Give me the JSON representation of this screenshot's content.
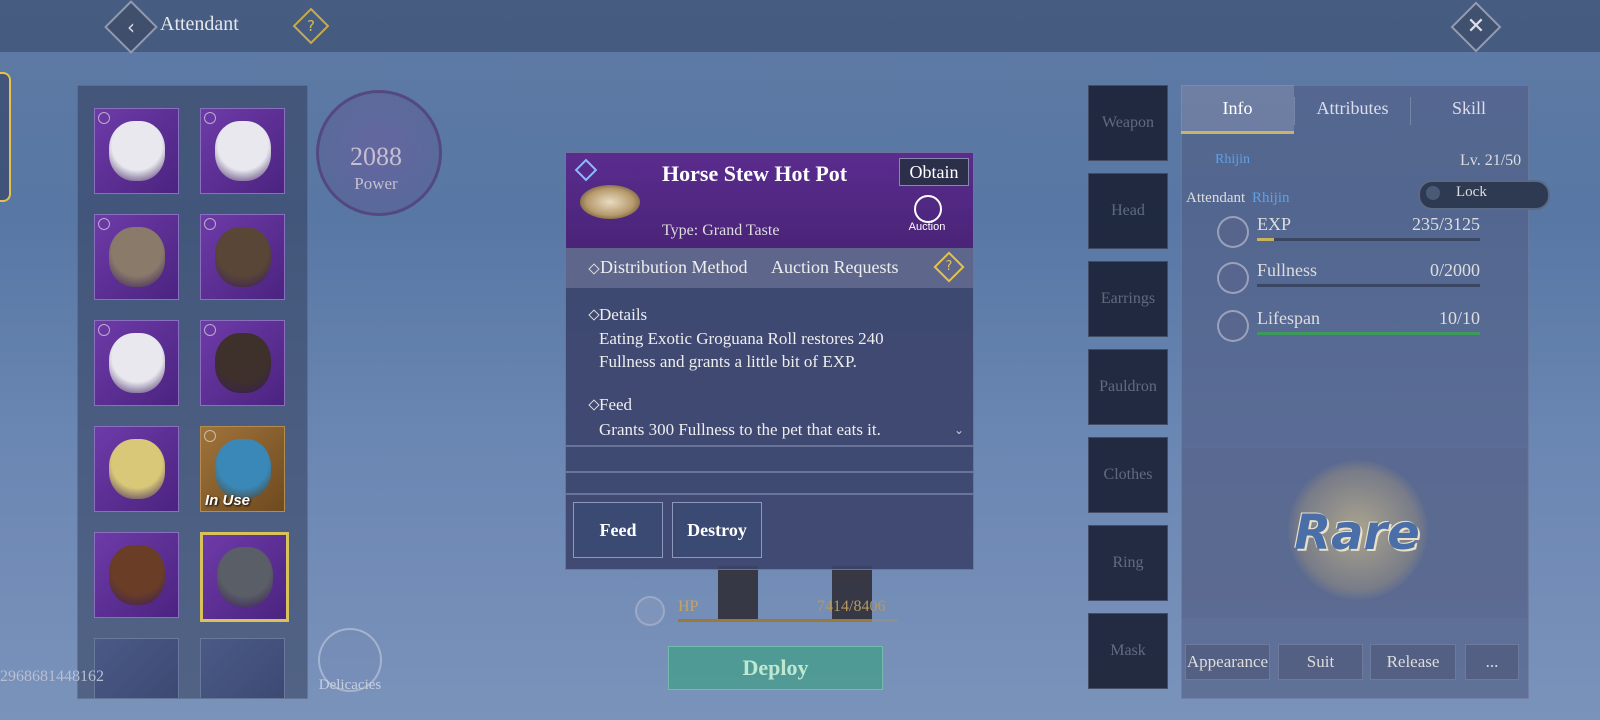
{
  "header": {
    "title": "Attendant",
    "help": "?",
    "back": "‹",
    "close": "✕"
  },
  "pets": [
    {
      "name": "white-fox",
      "color": "#e8e8ee",
      "in_use": false,
      "locked": true
    },
    {
      "name": "white-fox",
      "color": "#e8e8ee",
      "in_use": false,
      "locked": true
    },
    {
      "name": "tabby-cat",
      "color": "#8a7a6a",
      "in_use": false,
      "locked": true
    },
    {
      "name": "buffalo",
      "color": "#5a4636",
      "in_use": false,
      "locked": true
    },
    {
      "name": "white-fox",
      "color": "#e8e8ee",
      "in_use": false,
      "locked": true
    },
    {
      "name": "chimpanzee",
      "color": "#3e302a",
      "in_use": false,
      "locked": true
    },
    {
      "name": "blonde-girl",
      "color": "#d8c878",
      "in_use": false,
      "locked": false
    },
    {
      "name": "parrot",
      "color": "#3a88b8",
      "in_use": true,
      "locked": true
    },
    {
      "name": "bear",
      "color": "#6a3e26",
      "in_use": false,
      "locked": false
    },
    {
      "name": "rhino",
      "color": "#5a5e66",
      "in_use": false,
      "locked": false,
      "selected": true
    }
  ],
  "in_use_label": "In Use",
  "power": {
    "value": "2088",
    "label": "Power"
  },
  "player_id": "2968681448162",
  "delicacies_label": "Delicacies",
  "item_popup": {
    "name": "Horse Stew Hot Pot",
    "obtain_label": "Obtain",
    "auction_label": "Auction",
    "type": "Type: Grand Taste",
    "distribution_label": "Distribution Method",
    "distribution_value": "Auction Requests",
    "details_heading": "Details",
    "details_text": "Eating Exotic Groguana Roll restores 240 Fullness and grants a little bit of EXP.",
    "feed_heading": "Feed",
    "feed_text": "Grants 300 Fullness to the pet that eats it.",
    "scroll_glyph": "⌄",
    "feed_button": "Feed",
    "destroy_button": "Destroy"
  },
  "hp": {
    "label": "HP",
    "value": "7414/8406",
    "fraction": 0.88
  },
  "deploy_label": "Deploy",
  "equipment_slots": [
    "Weapon",
    "Head",
    "Earrings",
    "Pauldron",
    "Clothes",
    "Ring",
    "Mask"
  ],
  "info": {
    "tabs": [
      "Info",
      "Attributes",
      "Skill"
    ],
    "pet_name": "Rhijin",
    "level": "Lv. 21/50",
    "attendant_label": "Attendant",
    "attendant_name": "Rhijin",
    "lock_label": "Lock",
    "stats": [
      {
        "label": "EXP",
        "value": "235/3125",
        "fraction": 0.075,
        "color": "#c8b25a"
      },
      {
        "label": "Fullness",
        "value": "0/2000",
        "fraction": 0.0,
        "color": "#c8b25a"
      },
      {
        "label": "Lifespan",
        "value": "10/10",
        "fraction": 1.0,
        "color": "#3e9a5a"
      }
    ],
    "rarity": "Rare",
    "buttons": [
      "Appearance",
      "Suit",
      "Release",
      "..."
    ]
  }
}
